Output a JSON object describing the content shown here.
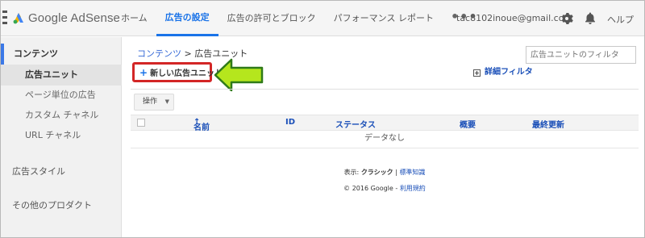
{
  "header": {
    "logo_text": "Google AdSense",
    "tabs": [
      {
        "label": "ホーム"
      },
      {
        "label": "広告の設定"
      },
      {
        "label": "広告の許可とブロック"
      },
      {
        "label": "パフォーマンス レポート"
      }
    ],
    "more_label": "•••",
    "account_email": "tac8102inoue@gmail.com",
    "help_label": "ヘルプ"
  },
  "sidebar": {
    "items": [
      {
        "label": "コンテンツ"
      },
      {
        "label": "広告ユニット"
      },
      {
        "label": "ページ単位の広告"
      },
      {
        "label": "カスタム チャネル"
      },
      {
        "label": "URL チャネル"
      },
      {
        "label": "広告スタイル"
      },
      {
        "label": "その他のプロダクト"
      }
    ]
  },
  "main": {
    "breadcrumb_parent": "コンテンツ",
    "breadcrumb_sep": " > ",
    "breadcrumb_current": "広告ユニット",
    "filter_placeholder": "広告ユニットのフィルタ",
    "new_unit_label": "新しい広告ユニット",
    "advanced_filter_label": "詳細フィルタ",
    "actions_label": "操作",
    "columns": {
      "name": "名前",
      "id": "ID",
      "status": "ステータス",
      "summary": "概要",
      "last_updated": "最終更新"
    },
    "empty_text": "データなし",
    "footer": {
      "display_label": "表示: ",
      "classic_label": "クラシック",
      "separator": " | ",
      "standard_label": "標準知識",
      "copyright": "© 2016 Google - ",
      "terms_label": "利用規約"
    }
  },
  "colors": {
    "accent": "#1a73e8",
    "highlight_border": "#d32626",
    "arrow_fill": "#b5e61d"
  }
}
